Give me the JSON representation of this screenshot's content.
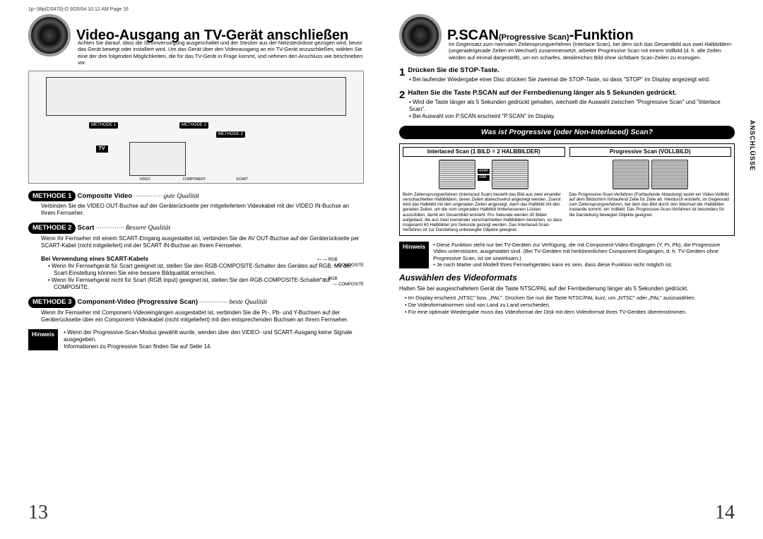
{
  "header_meta": "1p~38p(DS470)-D  9/20/04 10:12 AM  Page 16",
  "left": {
    "title": "Video-Ausgang an TV-Gerät anschließen",
    "intro": "Achten Sie darauf, dass die Stromversorgung ausgeschaltet und der Stecker aus der Netzsteckdose gezogen wird, bevor das Gerät bewegt oder installiert wird. Um das Gerät über den Videoausgang an ein TV-Gerät anzuschließen, wählen Sie eine der drei folgenden Möglichkeiten, die für das TV-Gerät in Frage kommt, und nehmen den Anschluss wie beschrieben vor.",
    "diagram": {
      "tv": "TV",
      "m1": "METHODE 1",
      "m2": "METHODE 2",
      "m3": "METHODE 3",
      "jacks": {
        "video": "VIDEO",
        "component": "COMPONENT",
        "scart": "SCART"
      },
      "switch": {
        "rgb": "RGB",
        "comp": "COMPOSITE"
      }
    },
    "method1": {
      "label": "METHODE 1",
      "title": "Composite Video",
      "dots": " ··············· ",
      "qual": "gute Qualität",
      "body": "Verbinden Sie die VIDEO OUT-Buchse auf der Geräterückseite per mitgeliefertem Videokabel mit der VIDEO IN-Buchse an Ihrem Fernseher."
    },
    "method2": {
      "label": "METHODE 2",
      "title": "Scart",
      "dots": " ··············· ",
      "qual": "Bessere Qualität",
      "body": "Wenn Ihr Fernseher mit einem SCART-Eingang ausgestattet ist, verbinden Sie die AV OUT-Buchse auf der Geräterückseite per SCART-Kabel (nicht mitgeliefert) mit der SCART IN-Buchse an Ihrem Fernseher.",
      "sub_h": "Bei Verwendung eines SCART-Kabels",
      "bullets": [
        "Wenn Ihr Fernsehgerät für Scart geeignet ist, stellen Sie den RGB-COMPOSITE-Schalter des Gerätes auf RGB. Mit der Scart-Einstellung können Sie eine bessere Bildqualität erreichen.",
        "Wenn Ihr Fernsehgerät nicht für Scart (RGB Input) geeignet ist, stellen Sie den RGB-COMPOSITE-Schalter auf COMPOSITE."
      ]
    },
    "method3": {
      "label": "METHODE 3",
      "title": "Component-Video (Progressive Scan)",
      "dots": " ··············· ",
      "qual": "beste Qualität",
      "body": "Wenn Ihr Fernseher mit Component-Videoeingängen ausgestattet ist, verbinden Sie die Pr-, Pb- und Y-Buchsen auf der Geräterückseite über ein Component-Videokabel (nicht mitgeliefert) mit den entsprechenden Buchsen an Ihrem Fernseher."
    },
    "hinweis": {
      "label": "Hinweis",
      "lines": [
        "Wenn der Progressive-Scan-Modus gewählt wurde, werden über den VIDEO- und SCART-Ausgang keine Signale ausgegeben.",
        "Informationen zu Progressive Scan finden Sie auf Seite 14."
      ]
    },
    "page_num": "13"
  },
  "right": {
    "title_big": "P.SCAN",
    "title_mid": "(Progressive Scan)",
    "title_end": "-Funktion",
    "intro": "Im Gegensatz zum normalen Zeilensprungverfahren (Interlace Scan), bei dem sich das Gesamtbild aus zwei Halbbildern (ungerade/gerade Zeilen im Wechsel) zusammensetzt, arbeitet Progressive Scan mit einem Vollbild (d. h. alle Zeilen werden auf einmal dargestellt), um ein scharfes, detailreiches Bild ohne sichtbare Scan-Zeilen zu erzeugen.",
    "step1": {
      "num": "1",
      "title": "Drücken Sie die STOP-Taste.",
      "body": "Bei laufender Wiedergabe einer Disc drücken Sie zweimal die STOP-Taste, so dass \"STOP\" im Display angezeigt wird."
    },
    "step2": {
      "num": "2",
      "title": "Halten Sie die Taste P.SCAN auf der Fernbedienung länger als 5 Sekunden gedrückt.",
      "b1": "Wird die Taste länger als 5 Sekunden gedrückt gehalten, wechselt die Auswahl zwischen \"Progressive Scan\" und \"Interlace Scan\".",
      "b2": "Bei Auswahl von P.SCAN erscheint \"P.SCAN\" im Display."
    },
    "banner": "Was ist Progressive (oder Non-Interlaced) Scan?",
    "col1_h": "Interlaced Scan (1 BILD = 2 HALBBILDER)",
    "col2_h": "Progressive Scan (VOLLBILD)",
    "even": "even",
    "odd": "odd",
    "col1_desc": "Beim Zeilensprungverfahren (Interlaced Scan) besteht das Bild aus zwei einander verschachtelten Halbbildern, deren Zeilen abwechselnd angezeigt werden. Zuerst wird das Halbbild mit den ungeraden Zeilen angezeigt, dann das Halbbild mit den geraden Zeilen, um die vom ungeraden Halbbild hinterlassenen Lücken auszufüllen, damit ein Gesamtbild entsteht. Pro Sekunde werden 30 Bilder aufgebaut, die aus zwei ineinander verschachtelten Halbbildern bestehen, so dass insgesamt 60 Halbbilder pro Sekunde gezeigt werden. Das Interlaced-Scan-Verfahren ist zur Darstellung unbewegter Objekte geeignet.",
    "col2_desc": "Das Progressive-Scan-Verfahren (Fortlaufende Abtastung) tastet ein Video-Vollbild auf dem Bildschirm fortlaufend Zeile für Zeile ab. Hierdurch entsteht, im Gegensatz zum Zeilensprungverfahren, bei dem das Bild durch den Wechsel der Halbbilder zustande kommt, ein Vollbild. Das Progressive-Scan-Verfahren ist besonders für die Darstellung bewegter Objekte geeignet.",
    "hinweis": {
      "label": "Hinweis",
      "lines": [
        "Diese Funktion steht nur bei TV-Geräten zur Verfügung, die mit Component-Video-Eingängen (Y, Pr, Pb), die Progressive Video unterstützen, ausgestattet sind. (Bei TV-Geräten mit herkömmlichen Component-Eingängen, d. h. TV-Geräten ohne Progressive Scan, ist sie unwirksam.)",
        "Je nach Marke und Modell Ihres Fernsehgerätes kann es sein, dass diese Funktion nicht möglich ist."
      ]
    },
    "format_h": "Auswählen des Videoformats",
    "format_intro": "Halten Sie bei ausgeschaltetem Gerät die Taste NTSC/PAL auf der Fernbedienung länger als 5 Sekunden gedrückt.",
    "format_list": [
      "Im Display erscheint „NTSC\" bzw. „PAL\". Drücken Sie nun die Taste NTSC/PAL kurz, um „NTSC\" oder „PAL\" auszuwählen.",
      "Die Videoformatnormen sind von Land zu Land verschieden.",
      "Für eine optimale Wiedergabe muss das Videoformat der Disk mit dem Videoformat Ihres TV-Gerätes übereinstimmen."
    ],
    "page_num": "14",
    "side_tab": "ANSCHLÜSSE"
  }
}
